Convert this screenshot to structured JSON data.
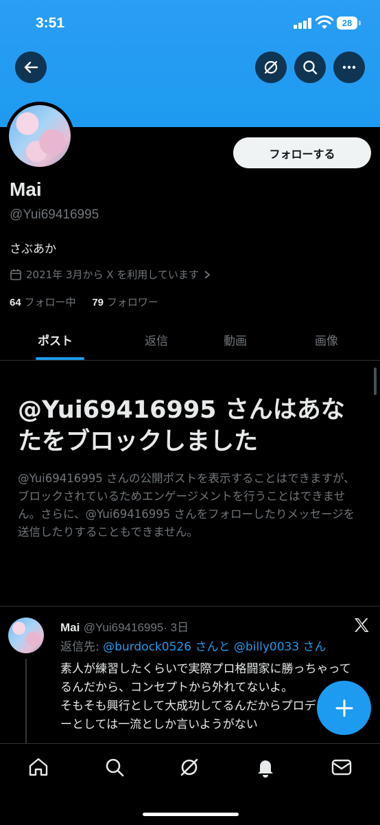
{
  "status_bar": {
    "time": "3:51",
    "battery": "28"
  },
  "header": {
    "back_icon": "arrow-left-icon",
    "grok_icon": "grok-icon",
    "search_icon": "search-icon",
    "more_icon": "ellipsis-icon"
  },
  "profile": {
    "name": "Mai",
    "handle": "@Yui69416995",
    "follow_label": "フォローする",
    "bio": "さぶあか",
    "joined": "2021年 3月から X を利用しています",
    "following_count": "64",
    "following_label": "フォロー中",
    "followers_count": "79",
    "followers_label": "フォロワー"
  },
  "tabs": [
    {
      "label": "ポスト",
      "active": true
    },
    {
      "label": "返信",
      "active": false
    },
    {
      "label": "動画",
      "active": false
    },
    {
      "label": "画像",
      "active": false
    }
  ],
  "blocked_notice": {
    "title": "@Yui69416995 さんはあなたをブロックしました",
    "description": "@Yui69416995 さんの公開ポストを表示することはできますが、ブロックされているためエンゲージメントを行うことはできません。さらに、@Yui69416995 さんをフォローしたりメッセージを送信したりすることもできません。"
  },
  "post": {
    "name": "Mai",
    "handle": "@Yui69416995",
    "time": "· 3日",
    "reply_prefix": "返信先: ",
    "reply_mention1": "@burdock0526",
    "reply_and": " さんと ",
    "reply_mention2": "@billy0033",
    "reply_suffix": " さん",
    "text": "素人が練習したくらいで実際プロ格闘家に勝っちゃってるんだから、コンセプトから外れてないよ。\nそもそも興行として大成功してるんだからプロデューサーとしては一流としか言いようがない"
  },
  "fab": {
    "icon": "plus-icon"
  },
  "bottom_nav": [
    "home-icon",
    "search-icon",
    "grok-icon",
    "bell-icon",
    "mail-icon"
  ],
  "colors": {
    "accent": "#1d9bf0",
    "background": "#000000",
    "muted": "#71767b"
  }
}
